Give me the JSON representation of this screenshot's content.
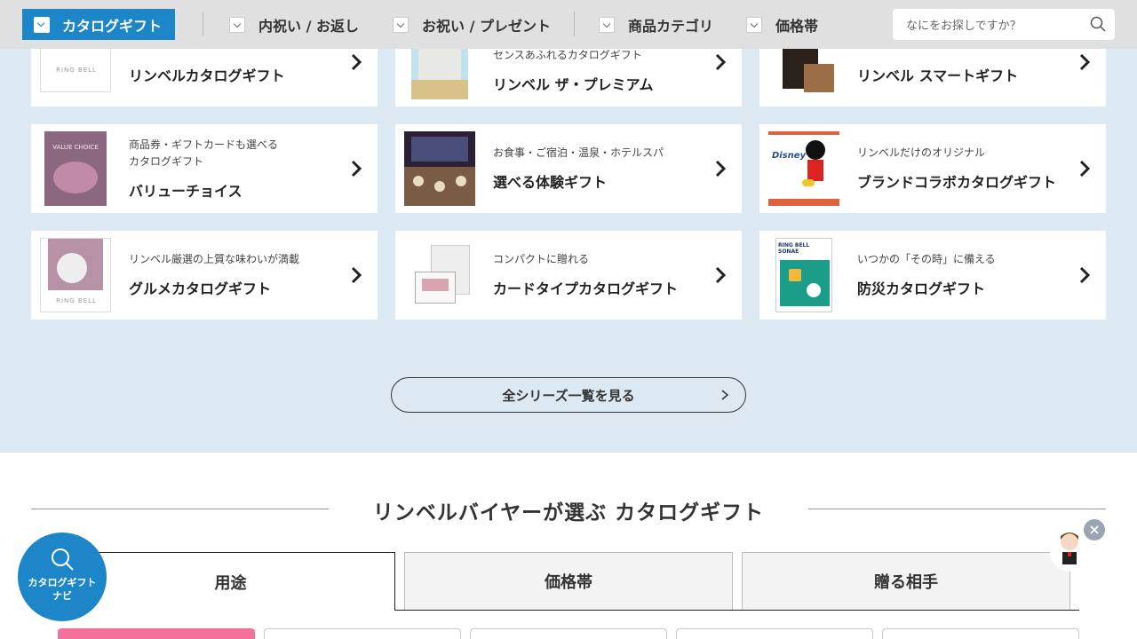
{
  "nav": {
    "active_label": "カタログギフト",
    "items": [
      {
        "label": "内祝い / お返し"
      },
      {
        "label": "お祝い / プレゼント"
      },
      {
        "label": "商品カテゴリ"
      },
      {
        "label": "価格帯"
      }
    ],
    "search_placeholder": "なにをお探しですか？"
  },
  "cards": [
    {
      "subtitle": "",
      "title": "リンベルカタログギフト",
      "thumb_text": "RING BELL"
    },
    {
      "subtitle": "センスあふれるカタログギフト",
      "title": "リンベル ザ・プレミアム"
    },
    {
      "subtitle": "",
      "title": "リンベル スマートギフト"
    },
    {
      "subtitle": "商品券・ギフトカードも選べる",
      "subtitle2": "カタログギフト",
      "title": "バリューチョイス",
      "thumb_text": "VALUE CHOICE"
    },
    {
      "subtitle": "お食事・ご宿泊・温泉・ホテルスパ",
      "title": "選べる体験ギフト"
    },
    {
      "subtitle": "リンベルだけのオリジナル",
      "title": "ブランドコラボカタログギフト",
      "thumb_text": "Disney"
    },
    {
      "subtitle": "リンベル厳選の上質な味わいが満載",
      "title": "グルメカタログギフト",
      "thumb_text": "RING BELL"
    },
    {
      "subtitle": "コンパクトに贈れる",
      "title": "カードタイプカタログギフト"
    },
    {
      "subtitle": "いつかの「その時」に備える",
      "title": "防災カタログギフト",
      "thumb_text": "RING BELL SONAE"
    }
  ],
  "all_series_button": "全シリーズ一覧を見る",
  "buyer_section": {
    "title": "リンベルバイヤーが選ぶ カタログギフト",
    "tabs": [
      {
        "label": "用途"
      },
      {
        "label": "価格帯"
      },
      {
        "label": "贈る相手"
      }
    ]
  },
  "fab": {
    "line1": "カタログギフト",
    "line2": "ナビ"
  },
  "colors": {
    "accent": "#1c86c8",
    "section_bg": "#dde9f2",
    "pink": "#f2729b"
  }
}
